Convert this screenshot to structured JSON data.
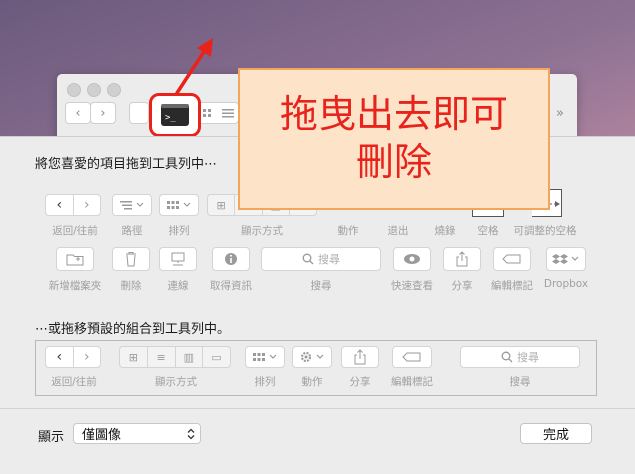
{
  "annotation": {
    "line1": "拖曳出去即可",
    "line2": "刪除",
    "color": "#e8231c"
  },
  "finder": {
    "back_glyph": "‹",
    "forward_glyph": "›",
    "more_glyph": "»"
  },
  "sheet": {
    "header": "將您喜愛的項目拖到工具列中⋯",
    "row1_labels": [
      "返回/往前",
      "路徑",
      "排列",
      "顯示方式",
      "動作",
      "退出",
      "燒錄",
      "空格",
      "可調整的空格"
    ],
    "row2_labels": [
      "新增檔案夾",
      "刪除",
      "連線",
      "取得資訊",
      "搜尋",
      "快速查看",
      "分享",
      "編輯標記",
      "Dropbox"
    ],
    "search_placeholder": "搜尋",
    "default_header": "⋯或拖移預設的組合到工具列中。",
    "default_labels": [
      "返回/往前",
      "顯示方式",
      "排列",
      "動作",
      "分享",
      "編輯標記",
      "搜尋"
    ],
    "show_label": "顯示",
    "show_value": "僅圖像",
    "done_label": "完成"
  }
}
